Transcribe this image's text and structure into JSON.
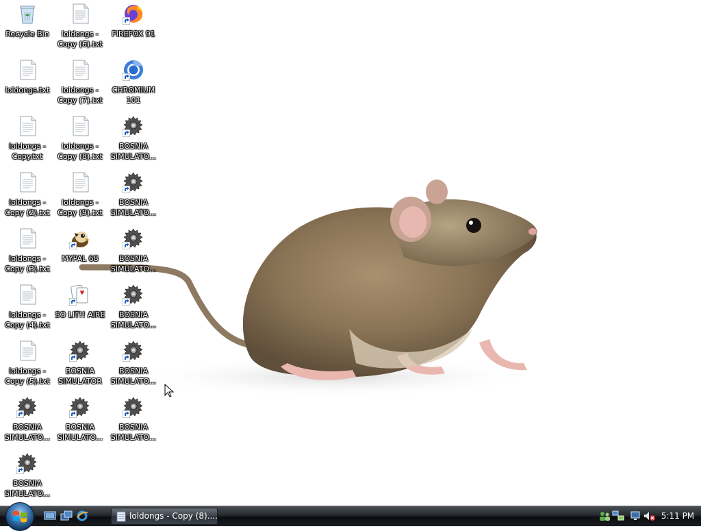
{
  "desktop_icons": [
    {
      "id": "recycle-bin",
      "label": "Recycle Bin",
      "icon": "recycle-bin-icon"
    },
    {
      "id": "txt-copy6",
      "label": "loldongs -\nCopy (6).txt",
      "icon": "text-file-icon"
    },
    {
      "id": "firefox",
      "label": "FIREFOX 91",
      "icon": "firefox-icon"
    },
    {
      "id": "txt-main",
      "label": "loldongs.txt",
      "icon": "text-file-icon"
    },
    {
      "id": "txt-copy7",
      "label": "loldongs -\nCopy (7).txt",
      "icon": "text-file-icon"
    },
    {
      "id": "chromium",
      "label": "CHROMIUM\n101",
      "icon": "chromium-icon"
    },
    {
      "id": "txt-copy",
      "label": "loldongs -\nCopy.txt",
      "icon": "text-file-icon"
    },
    {
      "id": "txt-copy8",
      "label": "loldongs -\nCopy (8).txt",
      "icon": "text-file-icon"
    },
    {
      "id": "bosnia-1",
      "label": "BOSNIA\nSIMULATO...",
      "icon": "gear-shortcut-icon"
    },
    {
      "id": "txt-copy2",
      "label": "loldongs -\nCopy (2).txt",
      "icon": "text-file-icon"
    },
    {
      "id": "txt-copy9",
      "label": "loldongs -\nCopy (9).txt",
      "icon": "text-file-icon"
    },
    {
      "id": "bosnia-2",
      "label": "BOSNIA\nSIMULATO...",
      "icon": "gear-shortcut-icon"
    },
    {
      "id": "txt-copy3",
      "label": "loldongs -\nCopy (3).txt",
      "icon": "text-file-icon"
    },
    {
      "id": "mypal",
      "label": "MYPAL 68",
      "icon": "mypal-icon"
    },
    {
      "id": "bosnia-3",
      "label": "BOSNIA\nSIMULATO...",
      "icon": "gear-shortcut-icon"
    },
    {
      "id": "txt-copy4",
      "label": "loldongs -\nCopy (4).txt",
      "icon": "text-file-icon"
    },
    {
      "id": "solitaire",
      "label": "SO LIT!! AIRE",
      "icon": "solitaire-icon"
    },
    {
      "id": "bosnia-4",
      "label": "BOSNIA\nSIMULATO...",
      "icon": "gear-shortcut-icon"
    },
    {
      "id": "txt-copy5",
      "label": "loldongs -\nCopy (5).txt",
      "icon": "text-file-icon"
    },
    {
      "id": "bosnia-sim",
      "label": "BOSNIA\nSIMULATOR",
      "icon": "gear-shortcut-icon"
    },
    {
      "id": "bosnia-5",
      "label": "BOSNIA\nSIMULATO...",
      "icon": "gear-shortcut-icon"
    },
    {
      "id": "bosnia-6",
      "label": "BOSNIA\nSIMULATO...",
      "icon": "gear-shortcut-icon"
    },
    {
      "id": "bosnia-7",
      "label": "BOSNIA\nSIMULATO...",
      "icon": "gear-shortcut-icon"
    },
    {
      "id": "bosnia-8",
      "label": "BOSNIA\nSIMULATO...",
      "icon": "gear-shortcut-icon"
    },
    {
      "id": "bosnia-9",
      "label": "BOSNIA\nSIMULATO...",
      "icon": "gear-shortcut-icon"
    }
  ],
  "taskbar": {
    "start_icon": "windows-logo-icon",
    "quick_launch": [
      "show-desktop-icon",
      "switch-windows-icon",
      "internet-explorer-icon"
    ],
    "active_task": {
      "label": "loldongs - Copy (8)....",
      "icon": "notepad-icon"
    },
    "tray_icons": [
      "user-network-icon",
      "network-icon",
      "display-icon",
      "volume-muted-icon"
    ],
    "clock": "5:11 PM"
  },
  "wallpaper": "rat-photo",
  "colors": {
    "taskbar": "#1a1d21",
    "label_text": "#ffffff",
    "start_orb": "#3f78b4"
  }
}
